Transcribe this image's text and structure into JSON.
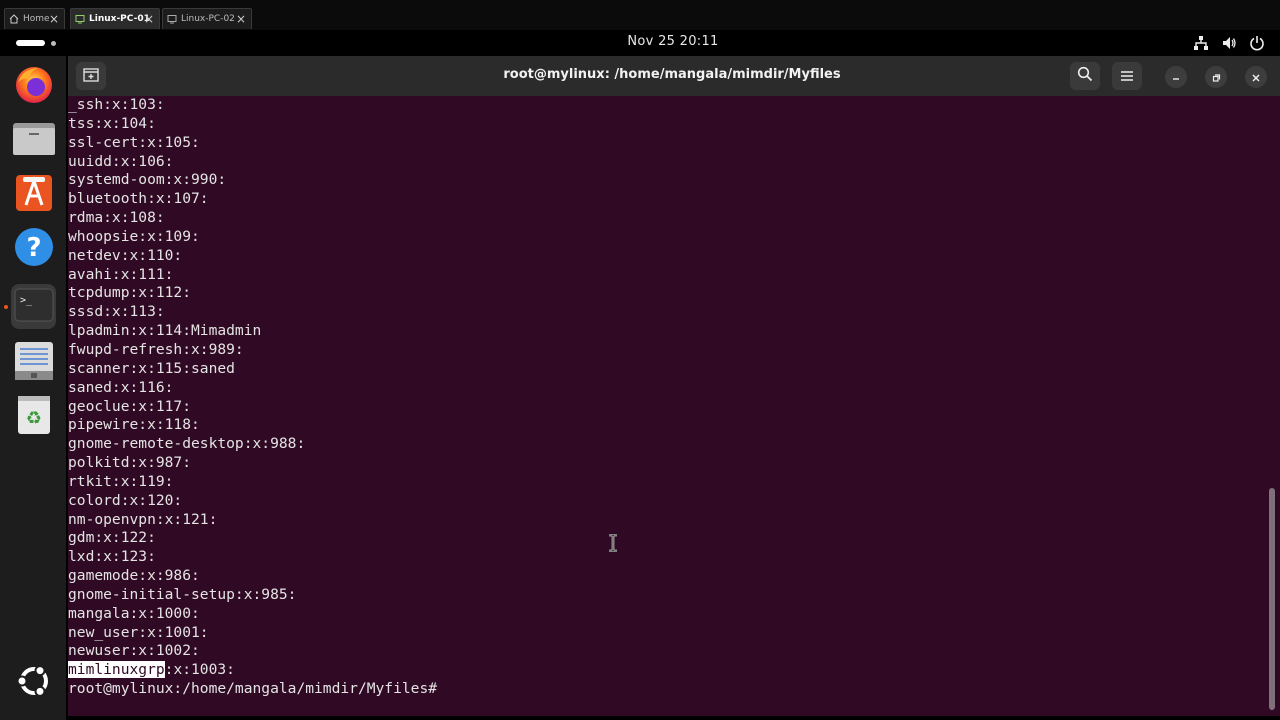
{
  "vm_tabs": [
    {
      "label": "Home",
      "icon": "home-icon",
      "active": false
    },
    {
      "label": "Linux-PC-01",
      "icon": "vm-icon",
      "active": true
    },
    {
      "label": "Linux-PC-02",
      "icon": "vm-icon",
      "active": false
    }
  ],
  "topbar": {
    "clock": "Nov 25  20:11",
    "tray_icons": [
      "network-icon",
      "volume-icon",
      "power-icon"
    ]
  },
  "dock": {
    "apps": [
      {
        "name": "Firefox",
        "icon": "firefox-icon"
      },
      {
        "name": "Files",
        "icon": "files-icon"
      },
      {
        "name": "App Center",
        "icon": "app-center-icon"
      },
      {
        "name": "Help",
        "icon": "help-icon"
      },
      {
        "name": "Terminal",
        "icon": "terminal-icon",
        "active": true
      },
      {
        "name": "Text Editor",
        "icon": "text-editor-icon"
      },
      {
        "name": "Trash",
        "icon": "trash-icon"
      }
    ],
    "show_apps_icon": "ubuntu-show-apps-icon"
  },
  "terminal": {
    "title": "root@mylinux: /home/mangala/mimdir/Myfiles",
    "lines": [
      "_ssh:x:103:",
      "tss:x:104:",
      "ssl-cert:x:105:",
      "uuidd:x:106:",
      "systemd-oom:x:990:",
      "bluetooth:x:107:",
      "rdma:x:108:",
      "whoopsie:x:109:",
      "netdev:x:110:",
      "avahi:x:111:",
      "tcpdump:x:112:",
      "sssd:x:113:",
      "lpadmin:x:114:Mimadmin",
      "fwupd-refresh:x:989:",
      "scanner:x:115:saned",
      "saned:x:116:",
      "geoclue:x:117:",
      "pipewire:x:118:",
      "gnome-remote-desktop:x:988:",
      "polkitd:x:987:",
      "rtkit:x:119:",
      "colord:x:120:",
      "nm-openvpn:x:121:",
      "gdm:x:122:",
      "lxd:x:123:",
      "gamemode:x:986:",
      "gnome-initial-setup:x:985:",
      "mangala:x:1000:",
      "new_user:x:1001:",
      "newuser:x:1002:"
    ],
    "highlight_line": {
      "selected": "mimlinuxgrp",
      "rest": ":x:1003:"
    },
    "prompt": "root@mylinux:/home/mangala/mimdir/Myfiles#"
  },
  "colors": {
    "terminal_bg": "#300a24",
    "headerbar_bg": "#2b2b2b",
    "dock_bg": "#1d1d1d",
    "accent": "#e95420"
  }
}
